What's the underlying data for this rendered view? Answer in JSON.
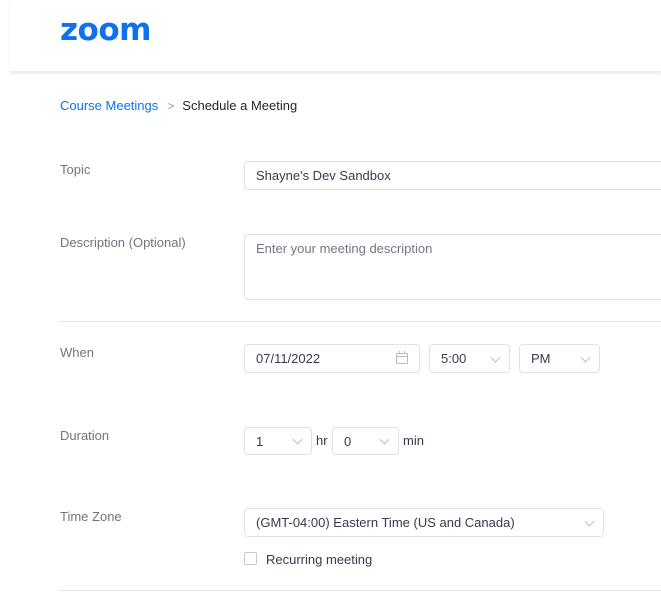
{
  "header": {
    "logo_text": "zoom"
  },
  "breadcrumb": {
    "parent": "Course Meetings",
    "separator": ">",
    "current": "Schedule a Meeting"
  },
  "form": {
    "topic": {
      "label": "Topic",
      "value": "Shayne's Dev Sandbox"
    },
    "description": {
      "label": "Description (Optional)",
      "value": "",
      "placeholder": "Enter your meeting description"
    },
    "when": {
      "label": "When",
      "date": "07/11/2022",
      "time": "5:00",
      "ampm": "PM"
    },
    "duration": {
      "label": "Duration",
      "hours": "1",
      "hours_unit": "hr",
      "minutes": "0",
      "minutes_unit": "min"
    },
    "time_zone": {
      "label": "Time Zone",
      "value": "(GMT-04:00) Eastern Time (US and Canada)"
    },
    "recurring": {
      "label": "Recurring meeting",
      "checked": false
    }
  },
  "icons": {
    "calendar": "calendar-icon",
    "dropdown": "chevron-down-icon"
  },
  "colors": {
    "accent": "#0e72ed",
    "label": "#6e7680",
    "border": "#dfe3e8"
  }
}
